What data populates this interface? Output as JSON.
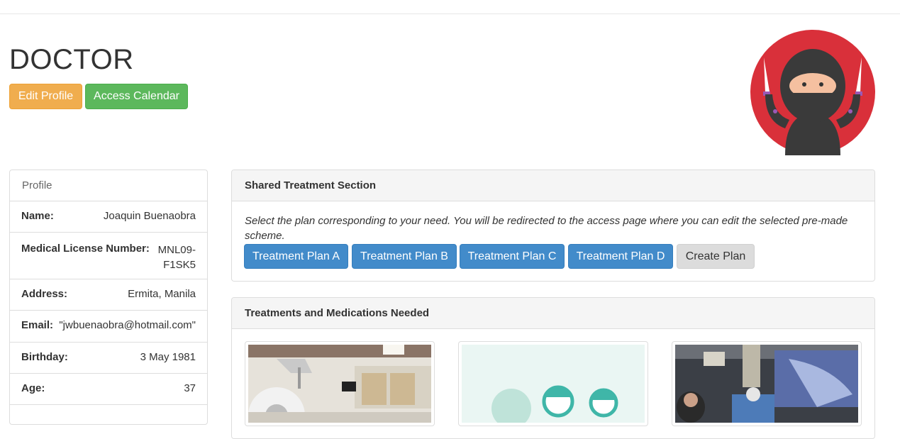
{
  "page": {
    "title": "DOCTOR"
  },
  "actions": {
    "edit_profile": "Edit Profile",
    "access_calendar": "Access Calendar"
  },
  "avatar": {
    "icon": "ninja-avatar-icon",
    "bg_color": "#d9303a"
  },
  "profile": {
    "heading": "Profile",
    "fields": [
      {
        "label": "Name:",
        "value": "Joaquin Buenaobra"
      },
      {
        "label": "Medical License Number:",
        "value": "MNL09-F1SK5"
      },
      {
        "label": "Address:",
        "value": "Ermita, Manila"
      },
      {
        "label": "Email:",
        "value": "\"jwbuenaobra@hotmail.com\""
      },
      {
        "label": "Birthday:",
        "value": "3 May 1981"
      },
      {
        "label": "Age:",
        "value": "37"
      }
    ]
  },
  "shared_treatment": {
    "heading": "Shared Treatment Section",
    "description": "Select the plan corresponding to your need. You will be redirected to the access page where you can edit the selected pre-made scheme.",
    "plans": [
      "Treatment Plan A",
      "Treatment Plan B",
      "Treatment Plan C",
      "Treatment Plan D"
    ],
    "create_label": "Create Plan"
  },
  "treatments": {
    "heading": "Treatments and Medications Needed",
    "images": [
      {
        "icon": "ct-scanner-room-image"
      },
      {
        "icon": "people-illustration-image"
      },
      {
        "icon": "surgery-room-image"
      }
    ]
  },
  "colors": {
    "warning": "#f0ad4e",
    "success": "#5cb85c",
    "primary": "#428bca",
    "default": "#dcdcdc"
  }
}
